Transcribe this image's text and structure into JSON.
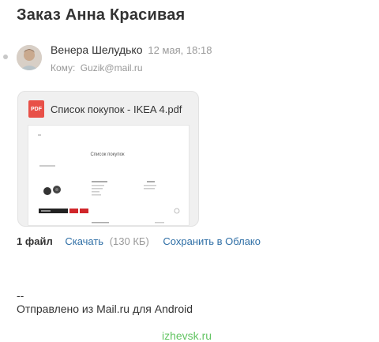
{
  "email": {
    "subject": "Заказ Анна Красивая",
    "sender_name": "Венера Шелудько",
    "sent_date": "12 мая, 18:18",
    "recipient_label": "Кому:",
    "recipient": "Guzik@mail.ru"
  },
  "attachment": {
    "icon": "pdf-file-icon",
    "icon_label": "PDF",
    "file_name": "Список покупок - IKEA 4.pdf",
    "preview": {
      "doc_title": "Список покупок"
    }
  },
  "attachments_footer": {
    "count_label": "1 файл",
    "download_label": "Скачать",
    "file_size": "(130 КБ)",
    "save_cloud_label": "Сохранить в Облако"
  },
  "signature": {
    "separator": "--",
    "text": "Отправлено из Mail.ru для Android"
  },
  "watermark": "izhevsk.ru",
  "colors": {
    "link": "#2f6fa6",
    "pdf_icon": "#e85048",
    "watermark": "#62c462",
    "muted_text": "#999999"
  }
}
